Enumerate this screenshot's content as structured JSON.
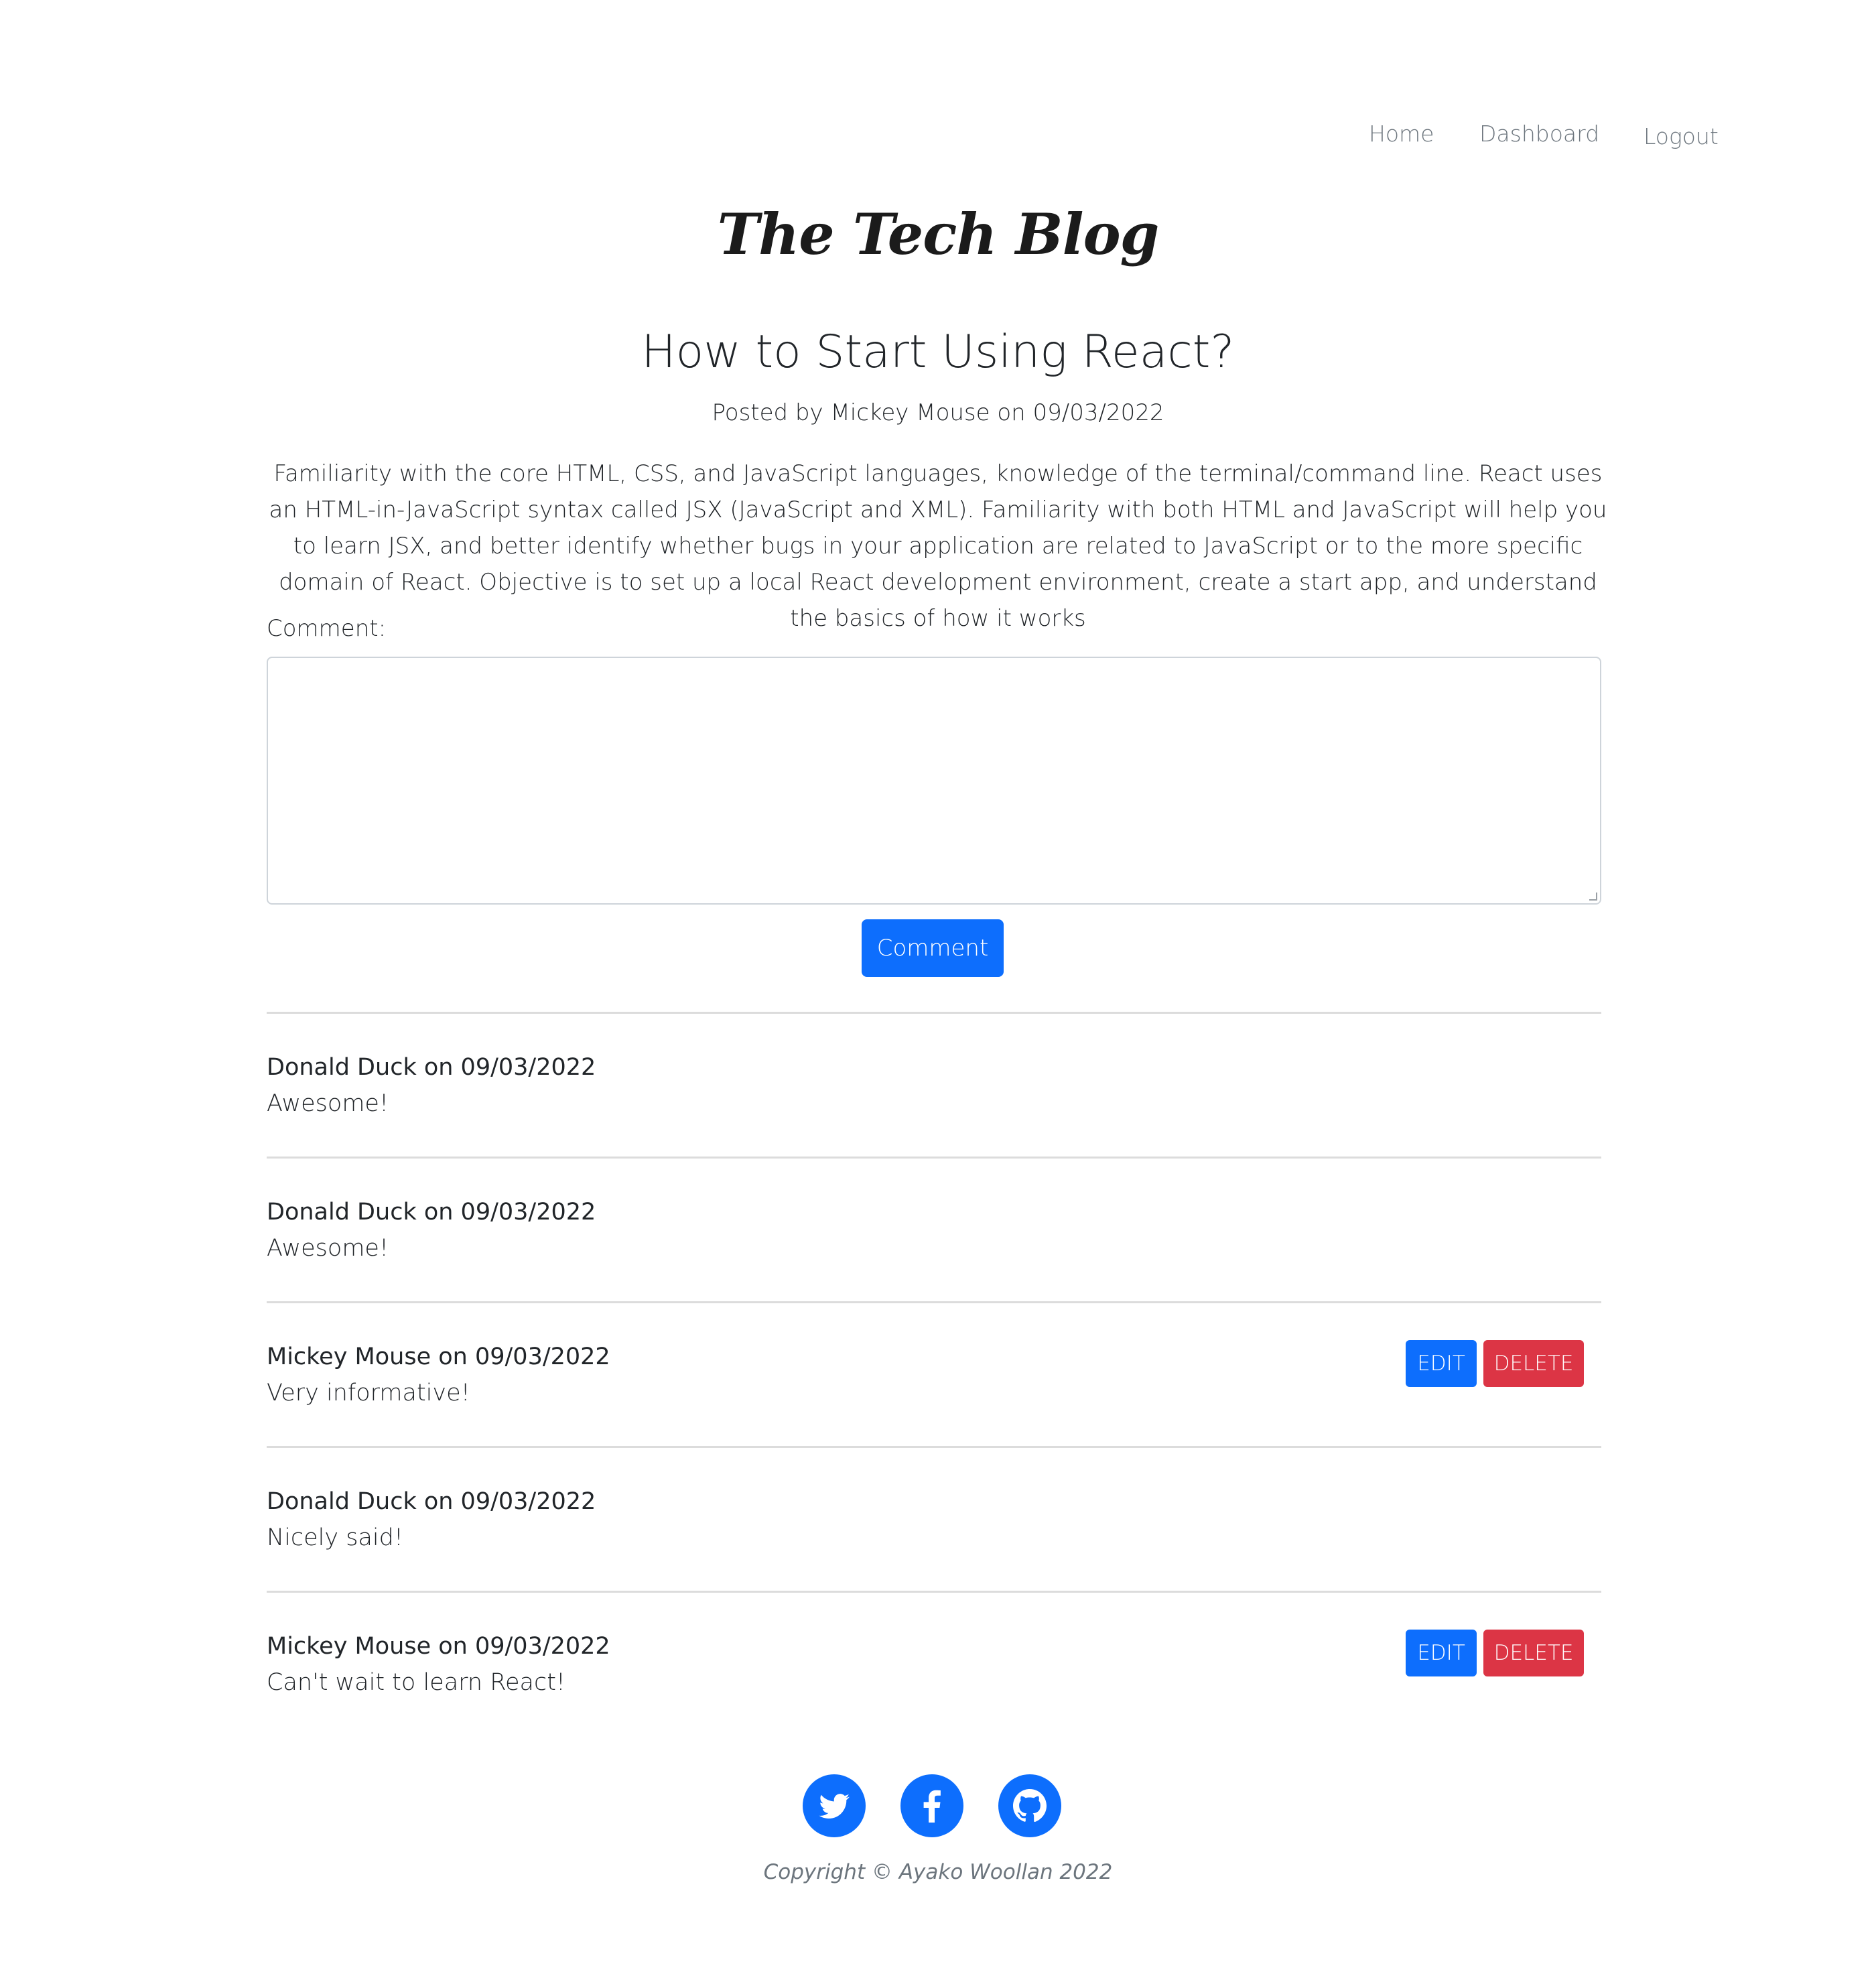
{
  "nav": {
    "home": "Home",
    "dashboard": "Dashboard",
    "logout": "Logout"
  },
  "logo": "The Tech Blog",
  "post": {
    "title": "How to Start Using React?",
    "byline": "Posted by Mickey Mouse on 09/03/2022",
    "body": "Familiarity with the core HTML, CSS, and JavaScript languages, knowledge of the terminal/command line. React uses an HTML-in-JavaScript syntax called JSX (JavaScript and XML). Familiarity with both HTML and JavaScript will help you to learn JSX, and better identify whether bugs in your application are related to JavaScript or to the more specific domain of React. Objective is to set up a local React development environment, create a start app, and understand the basics of how it works"
  },
  "comment_form": {
    "label": "Comment:",
    "value": "",
    "button": "Comment"
  },
  "comments": [
    {
      "meta": "Donald Duck on 09/03/2022",
      "text": "Awesome!",
      "editable": false
    },
    {
      "meta": "Donald Duck on 09/03/2022",
      "text": "Awesome!",
      "editable": false
    },
    {
      "meta": "Mickey Mouse on 09/03/2022",
      "text": "Very informative!",
      "editable": true,
      "edit_label": "EDIT",
      "delete_label": "DELETE"
    },
    {
      "meta": "Donald Duck on 09/03/2022",
      "text": "Nicely said!",
      "editable": false
    },
    {
      "meta": "Mickey Mouse on 09/03/2022",
      "text": "Can't wait to learn React!",
      "editable": true,
      "edit_label": "EDIT",
      "delete_label": "DELETE"
    }
  ],
  "footer": {
    "social_icons": [
      "twitter-icon",
      "facebook-icon",
      "github-icon"
    ],
    "copyright": "Copyright © Ayako Woollan 2022"
  },
  "colors": {
    "primary": "#0d6efd",
    "danger": "#dc3545",
    "muted": "#6c757d",
    "divider": "#dcdcdc"
  }
}
